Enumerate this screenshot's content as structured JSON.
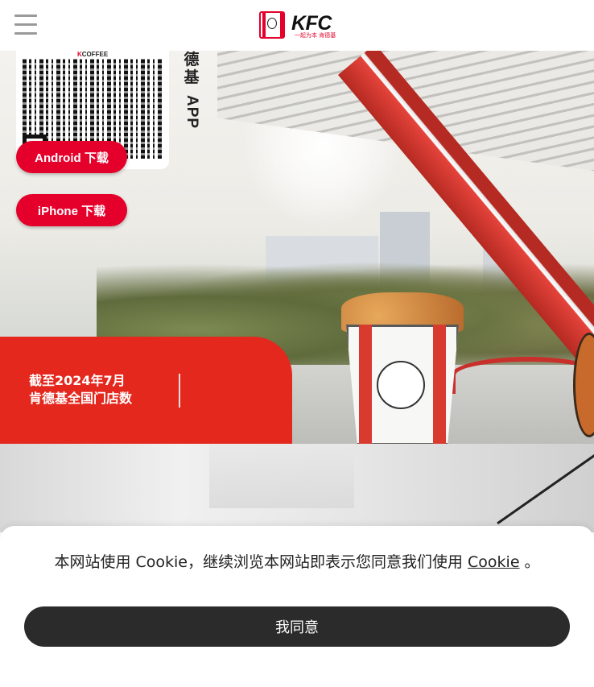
{
  "header": {
    "menu_icon": "hamburger-menu-icon",
    "logo_text": "KFC",
    "logo_sub": "一起为本 肯德基"
  },
  "hero": {
    "qr_brand_k": "K",
    "qr_brand_rest": "COFFEE",
    "app_label_chars": "德基",
    "app_label_latin": "APP",
    "android_button": "Android 下载",
    "iphone_button": "iPhone 下载"
  },
  "stats": {
    "label_line1": "截至2024年7月",
    "label_line2": "肯德基全国门店数",
    "value": ""
  },
  "cookie": {
    "text_before": "本网站使用 Cookie，继续浏览本网站即表示您同意我们使用 ",
    "link": "Cookie",
    "text_after": " 。",
    "agree_button": "我同意"
  },
  "colors": {
    "brand_red": "#e4002b",
    "stats_red": "#e4281e",
    "agree_bg": "#2b2b2b"
  }
}
